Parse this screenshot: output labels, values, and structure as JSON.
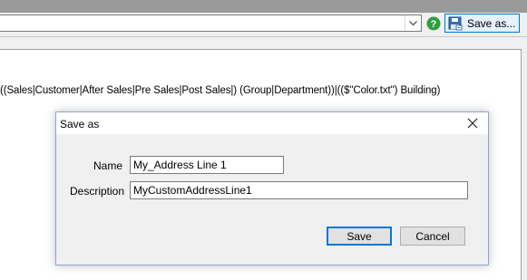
{
  "toolbar": {
    "help_icon": "question-circle-icon",
    "save_as_label": "Save as...",
    "save_as_icon": "save-as-icon",
    "dropdown_icon": "chevron-down-icon"
  },
  "content": {
    "expression": "((Sales|Customer|After Sales|Pre Sales|Post Sales|) (Group|Department))|(($\"Color.txt\") Building)"
  },
  "dialog": {
    "title": "Save as",
    "name_label": "Name",
    "name_value": "My_Address Line 1",
    "description_label": "Description",
    "description_value": "MyCustomAddressLine1",
    "save_label": "Save",
    "cancel_label": "Cancel"
  },
  "colors": {
    "accent": "#0078d7",
    "help_green": "#2e9e3f"
  }
}
